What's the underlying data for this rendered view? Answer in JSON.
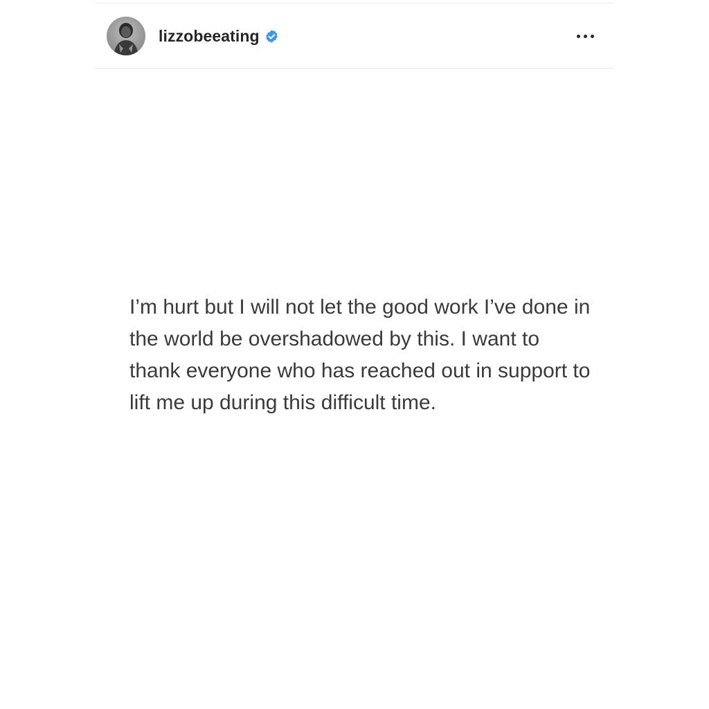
{
  "post": {
    "header": {
      "username": "lizzobeeating",
      "verified_icon": "verified-badge-icon",
      "more_icon": "more-options-icon",
      "accent_color": "#3897f0"
    },
    "image_text": "I’m hurt but I will not let the good work I’ve done in the world be overshadowed by this. I want to thank everyone who has reached out in support to lift me up during this difficult time."
  }
}
